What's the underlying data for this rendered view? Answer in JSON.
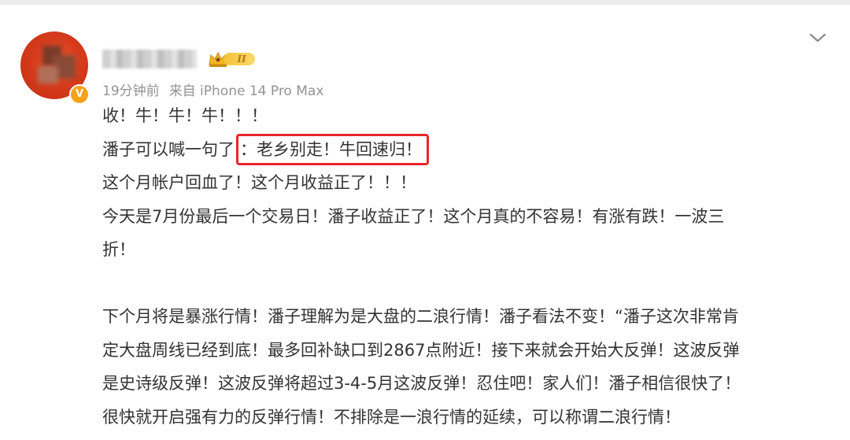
{
  "post": {
    "author_badge": "V",
    "level_label": "II",
    "time": "19分钟前",
    "source": "来自 iPhone 14 Pro Max",
    "lines": [
      "收！牛！牛！牛！！！",
      "潘子可以喊一句了",
      "：老乡别走！牛回速归！",
      "这个月帐户回血了！这个月收益正了！！！",
      "今天是7月份最后一个交易日！潘子收益正了！这个月真的不容易！有涨有跌！一波三",
      "折！",
      "下个月将是暴涨行情！潘子理解为是大盘的二浪行情！潘子看法不变！“潘子这次非常肯",
      "定大盘周线已经到底！最多回补缺口到2867点附近！接下来就会开始大反弹！这波反弹",
      "是史诗级反弹！这波反弹将超过3-4-5月这波反弹！忍住吧！家人们！潘子相信很快了！",
      "很快就开启强有力的反弹行情！不排除是一浪行情的延续，可以称谓二浪行情！"
    ]
  },
  "icons": {
    "more": "chevron-down-icon",
    "crown": "crown-icon",
    "verified": "verified-badge-icon"
  },
  "colors": {
    "text": "#333333",
    "meta": "#939393",
    "highlight_border": "#e8262b",
    "avatar": "#d63b1c",
    "verified": "#f7a21b",
    "level": "#f6c339"
  }
}
